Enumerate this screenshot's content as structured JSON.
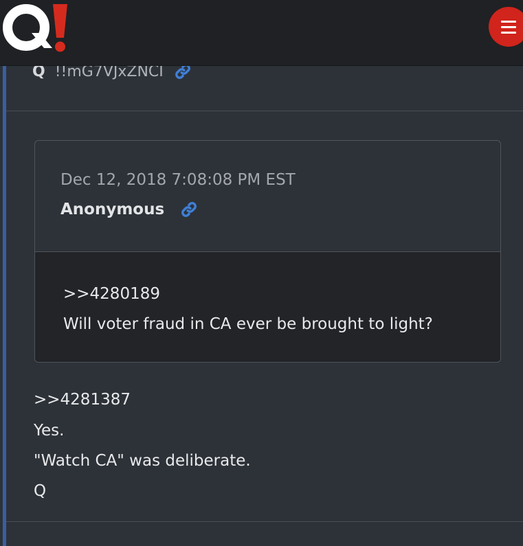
{
  "header": {
    "logo_text": "Q!"
  },
  "post": {
    "author": "Q",
    "tripcode": "!!mG7VJxZNCI",
    "quoted": {
      "date": "Dec 12, 2018 7:08:08 PM EST",
      "author": "Anonymous",
      "reply_ref": ">>4280189",
      "text": "Will voter fraud in CA ever be brought to light?"
    },
    "reply_ref": ">>4281387",
    "lines": [
      "Yes.",
      "\"Watch CA\" was deliberate.",
      "Q"
    ]
  },
  "icons": {
    "link": "link-icon",
    "menu": "hamburger-menu-icon"
  },
  "colors": {
    "background": "#2d3239",
    "header": "#1f2124",
    "accent": "#3a5fa0",
    "menu_button": "#d0241c",
    "link_icon": "#3f7fd6",
    "logo_exclamation": "#d52b1e"
  }
}
